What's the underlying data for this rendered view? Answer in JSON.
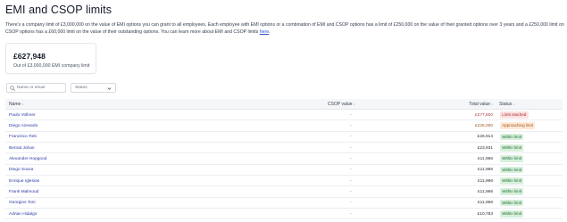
{
  "page": {
    "title": "EMI and CSOP limits",
    "intro_text": "There's a company limit of £3,000,000 on the value of EMI options you can grant to all employees. Each employee with EMI options or a combination of EMI and CSOP options has a limit of £250,000 on the value of their granted options over 3 years and a £250,000 limit on CSOP options has a £60,000 limit on the value of their outstanding options. You can learn more about EMI and CSOP limits",
    "intro_link": "here",
    "intro_end": "."
  },
  "summary": {
    "value": "£627,948",
    "caption": "Out of £3,000,000 EMI company limit"
  },
  "filters": {
    "search_placeholder": "Name or email",
    "status_label": "Status"
  },
  "icons": {
    "search": "search-icon",
    "dropdown": "chevron-down-icon",
    "sort": "sort-icon"
  },
  "colors": {
    "link": "#2f4fd0",
    "within_limit_bg": "#d7f0db",
    "limit_reached_bg": "#fde2e2",
    "approaching_limit_bg": "#fde8d5"
  },
  "table": {
    "headers": {
      "name": "Name",
      "csop_value": "CSOP value",
      "total_value": "Total value",
      "status": "Status"
    },
    "sort_symbol": "↕",
    "total_sort_symbol": "↓",
    "rows": [
      {
        "name": "Paulo Vollmer",
        "csop": "-",
        "total": "£277,500",
        "status": "Limit reached",
        "kind": "reached"
      },
      {
        "name": "Diego Azevedo",
        "csop": "-",
        "total": "£225,000",
        "status": "Approaching limit",
        "kind": "approach"
      },
      {
        "name": "Francisco Totti",
        "csop": "-",
        "total": "£26,914",
        "status": "Within limit",
        "kind": "within"
      },
      {
        "name": "Bernat Johan",
        "csop": "-",
        "total": "£23,931",
        "status": "Within limit",
        "kind": "within"
      },
      {
        "name": "Alexander Hopgood",
        "csop": "-",
        "total": "£11,966",
        "status": "Within limit",
        "kind": "within"
      },
      {
        "name": "Diego Souza",
        "csop": "-",
        "total": "£11,966",
        "status": "Within limit",
        "kind": "within"
      },
      {
        "name": "Enrique Iglesias",
        "csop": "-",
        "total": "£11,966",
        "status": "Within limit",
        "kind": "within"
      },
      {
        "name": "Frank Malmoud",
        "csop": "-",
        "total": "£11,966",
        "status": "Within limit",
        "kind": "within"
      },
      {
        "name": "Georgios Toni",
        "csop": "-",
        "total": "£11,966",
        "status": "Within limit",
        "kind": "within"
      },
      {
        "name": "Adrian Hidalgo",
        "csop": "-",
        "total": "£10,783",
        "status": "Within limit",
        "kind": "within"
      }
    ]
  }
}
